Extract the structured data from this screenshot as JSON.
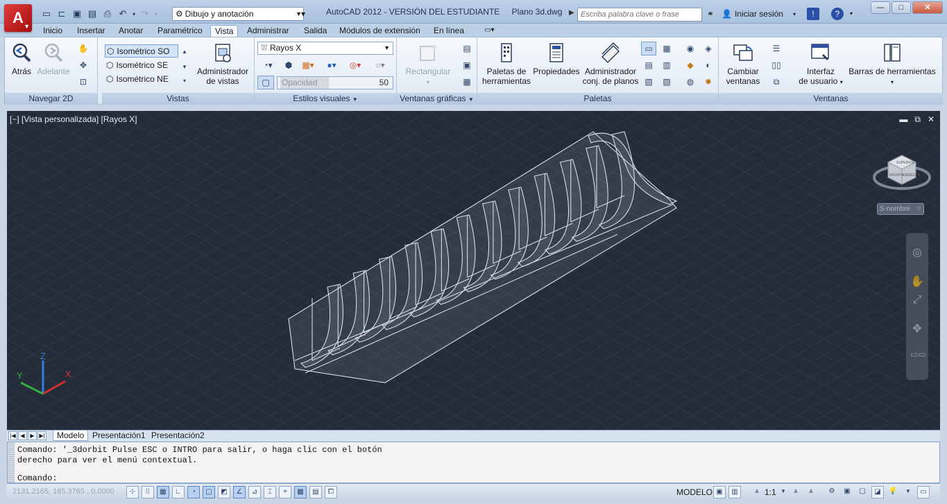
{
  "titlebar": {
    "workspace": "Dibujo y anotación",
    "app_title": "AutoCAD 2012 - VERSIÓN DEL ESTUDIANTE",
    "file_name": "Plano 3d.dwg",
    "search_placeholder": "Escriba palabra clave o frase",
    "signin_label": "Iniciar sesión",
    "logo_letter": "A"
  },
  "ribbon_tabs": [
    "Inicio",
    "Insertar",
    "Anotar",
    "Paramétrico",
    "Vista",
    "Administrar",
    "Salida",
    "Módulos de extensión",
    "En línea"
  ],
  "ribbon_active_tab": "Vista",
  "panels": {
    "navegar": {
      "title": "Navegar 2D",
      "back": "Atrás",
      "forward": "Adelante"
    },
    "vistas": {
      "title": "Vistas",
      "items": [
        "Isométrico SO",
        "Isométrico SE",
        "Isométrico NE"
      ],
      "manager_line1": "Administrador",
      "manager_line2": "de vistas"
    },
    "estilos": {
      "title": "Estilos visuales",
      "style": "Rayos X",
      "opacity_label": "Opacidad",
      "opacity_value": "50"
    },
    "ventanas_graficas": {
      "title": "Ventanas gráficas",
      "rect_label": "Rectangular"
    },
    "paletas": {
      "title": "Paletas",
      "tool_palettes_1": "Paletas de",
      "tool_palettes_2": "herramientas",
      "properties": "Propiedades",
      "sheet_mgr_1": "Administrador",
      "sheet_mgr_2": "conj. de planos"
    },
    "ventanas": {
      "title": "Ventanas",
      "switch_1": "Cambiar",
      "switch_2": "ventanas",
      "ui_1": "Interfaz",
      "ui_2": "de usuario",
      "toolbars": "Barras de herramientas"
    }
  },
  "viewport": {
    "label": "[−] [Vista personalizada] [Rayos X]",
    "ucs_name": "S-nombre",
    "viewcube_top": "SUPERIOR",
    "viewcube_front": "FRONTAL",
    "viewcube_right": "DERECHA"
  },
  "layout_tabs": [
    "Modelo",
    "Presentación1",
    "Presentación2"
  ],
  "command": {
    "history_line1": "Comando: '_3dorbit Pulse ESC o INTRO para salir, o haga clic con el botón",
    "history_line2": "derecho para ver el menú contextual.",
    "prompt": "Comando:"
  },
  "status": {
    "coords": "2131.2165, 185.3765 , 0.0000",
    "model": "MODELO",
    "scale": "1:1"
  },
  "colors": {
    "viewport_bg": "#242c39",
    "ribbon_bg": "#dfe8f3",
    "model_line": "#d8dde6"
  }
}
